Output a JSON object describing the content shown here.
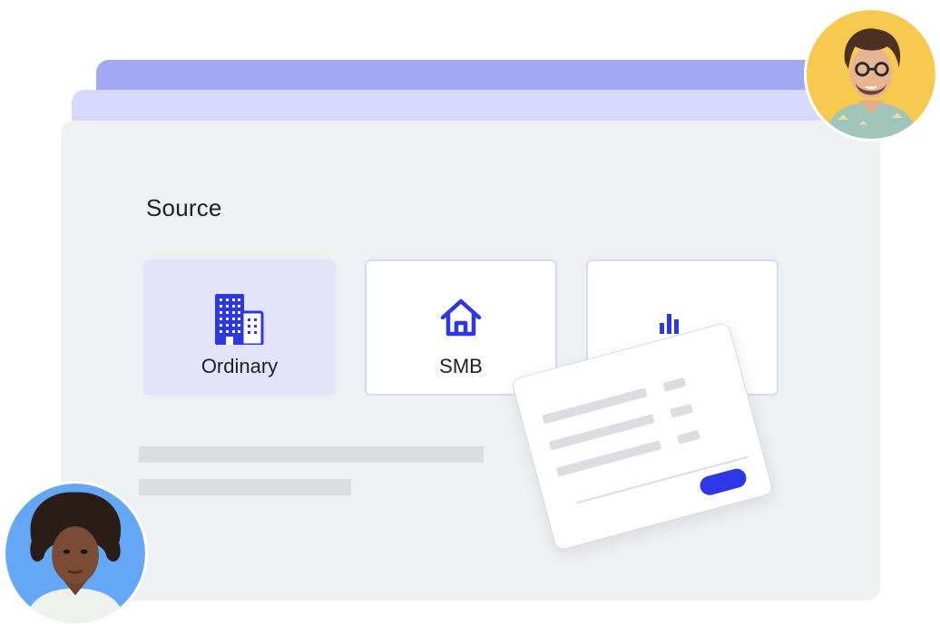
{
  "source": {
    "title": "Source",
    "options": [
      {
        "label": "Ordinary",
        "icon": "building-icon",
        "selected": true
      },
      {
        "label": "SMB",
        "icon": "home-icon",
        "selected": false
      },
      {
        "label": "",
        "icon": "bar-chart-icon",
        "selected": false
      }
    ]
  },
  "colors": {
    "accent": "#2e37e6",
    "selected_card": "#e3e4fb",
    "panel": "#eff0f2",
    "stack_back": "#a3a8f4",
    "stack_mid": "#d6d8fc",
    "avatar_right_bg": "#f7c94e",
    "avatar_left_bg": "#64a7f5"
  }
}
